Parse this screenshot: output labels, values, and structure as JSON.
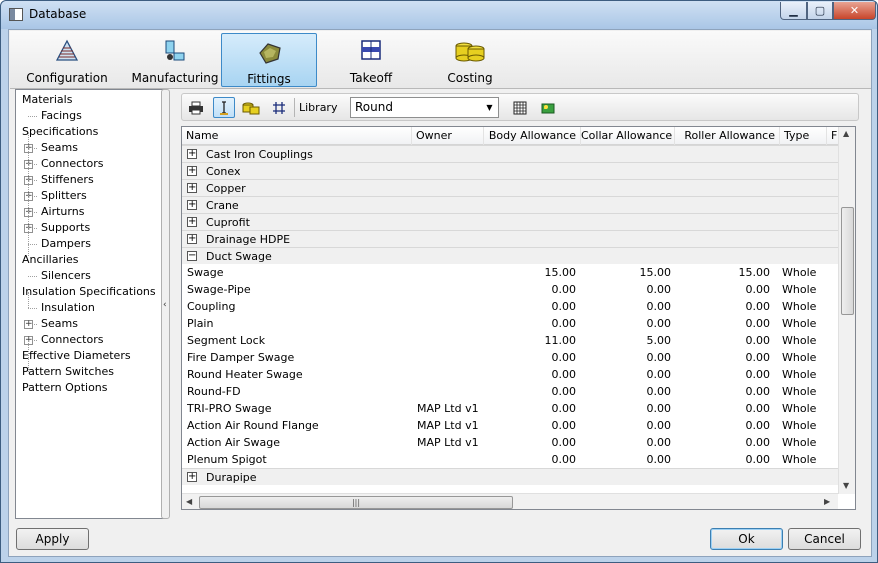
{
  "window": {
    "title": "Database"
  },
  "ribbon": {
    "tabs": [
      {
        "label": "Configuration",
        "icon": "configuration-icon"
      },
      {
        "label": "Manufacturing",
        "icon": "manufacturing-icon"
      },
      {
        "label": "Fittings",
        "icon": "fittings-icon",
        "active": true
      },
      {
        "label": "Takeoff",
        "icon": "takeoff-icon"
      },
      {
        "label": "Costing",
        "icon": "costing-icon"
      }
    ]
  },
  "tree": {
    "items": [
      {
        "label": "Materials"
      },
      {
        "label": "Facings"
      },
      {
        "label": "Specifications"
      },
      {
        "label": "Seams"
      },
      {
        "label": "Connectors"
      },
      {
        "label": "Stiffeners"
      },
      {
        "label": "Splitters"
      },
      {
        "label": "Airturns"
      },
      {
        "label": "Supports"
      },
      {
        "label": "Dampers"
      },
      {
        "label": "Ancillaries"
      },
      {
        "label": "Silencers"
      },
      {
        "label": "Insulation Specifications"
      },
      {
        "label": "Insulation"
      },
      {
        "label": "Seams"
      },
      {
        "label": "Connectors"
      },
      {
        "label": "Effective Diameters"
      },
      {
        "label": "Pattern Switches"
      },
      {
        "label": "Pattern Options"
      }
    ]
  },
  "toolbar": {
    "library_label": "Library",
    "library_value": "Round"
  },
  "grid": {
    "columns": [
      "Name",
      "Owner",
      "Body Allowance",
      "Collar Allowance",
      "Roller Allowance",
      "Type",
      "F"
    ],
    "groups_before": [
      "Cast Iron Couplings",
      "Conex",
      "Copper",
      "Crane",
      "Cuprofit",
      "Drainage HDPE"
    ],
    "expanded_group": "Duct Swage",
    "rows": [
      {
        "name": "Swage",
        "owner": "",
        "body": "15.00",
        "collar": "15.00",
        "roller": "15.00",
        "type": "Whole"
      },
      {
        "name": "Swage-Pipe",
        "owner": "",
        "body": "0.00",
        "collar": "0.00",
        "roller": "0.00",
        "type": "Whole"
      },
      {
        "name": "Coupling",
        "owner": "",
        "body": "0.00",
        "collar": "0.00",
        "roller": "0.00",
        "type": "Whole"
      },
      {
        "name": "Plain",
        "owner": "",
        "body": "0.00",
        "collar": "0.00",
        "roller": "0.00",
        "type": "Whole"
      },
      {
        "name": "Segment Lock",
        "owner": "",
        "body": "11.00",
        "collar": "5.00",
        "roller": "0.00",
        "type": "Whole"
      },
      {
        "name": "Fire Damper Swage",
        "owner": "",
        "body": "0.00",
        "collar": "0.00",
        "roller": "0.00",
        "type": "Whole"
      },
      {
        "name": "Round Heater Swage",
        "owner": "",
        "body": "0.00",
        "collar": "0.00",
        "roller": "0.00",
        "type": "Whole"
      },
      {
        "name": "Round-FD",
        "owner": "",
        "body": "0.00",
        "collar": "0.00",
        "roller": "0.00",
        "type": "Whole"
      },
      {
        "name": "TRI-PRO Swage",
        "owner": "MAP Ltd v1",
        "body": "0.00",
        "collar": "0.00",
        "roller": "0.00",
        "type": "Whole"
      },
      {
        "name": "Action Air Round Flange",
        "owner": "MAP Ltd v1",
        "body": "0.00",
        "collar": "0.00",
        "roller": "0.00",
        "type": "Whole"
      },
      {
        "name": "Action Air Swage",
        "owner": "MAP Ltd v1",
        "body": "0.00",
        "collar": "0.00",
        "roller": "0.00",
        "type": "Whole"
      },
      {
        "name": "Plenum Spigot",
        "owner": "",
        "body": "0.00",
        "collar": "0.00",
        "roller": "0.00",
        "type": "Whole"
      }
    ],
    "groups_after": [
      "Durapipe"
    ]
  },
  "buttons": {
    "apply": "Apply",
    "ok": "Ok",
    "cancel": "Cancel"
  }
}
